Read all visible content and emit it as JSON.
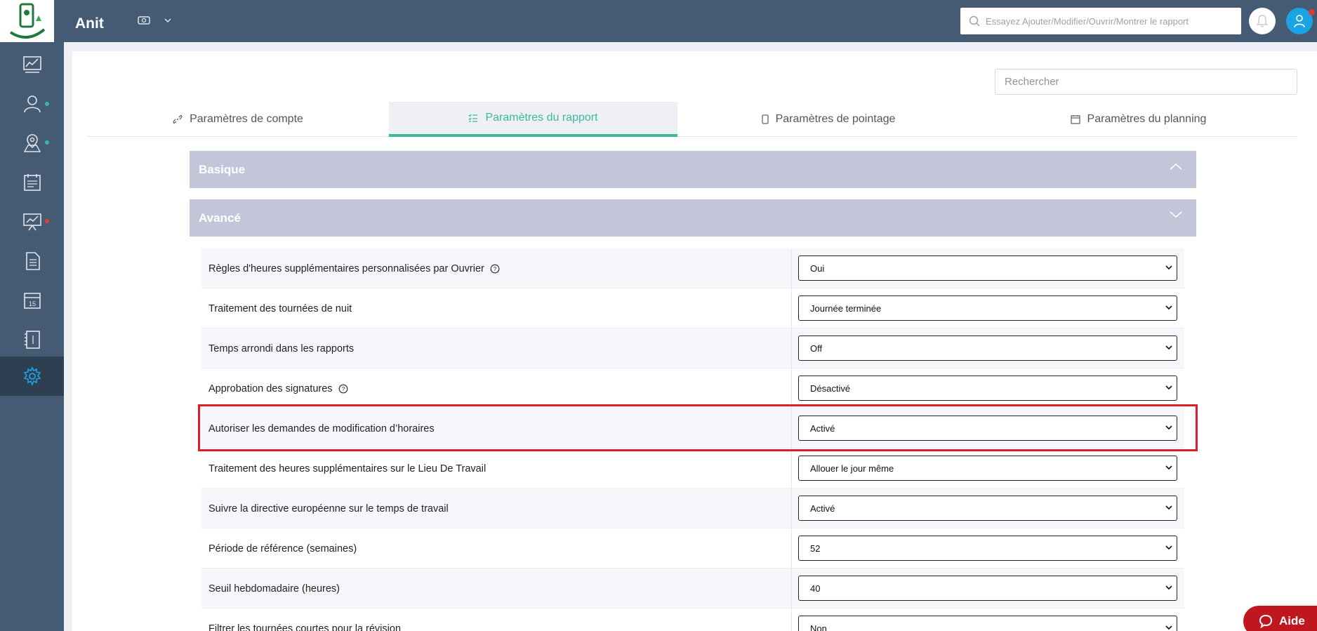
{
  "header": {
    "app_name": "Anit",
    "search_placeholder": "Essayez Ajouter/Modifier/Ouvrir/Montrer le rapport",
    "accent": "#1ba3e3",
    "notification_color": "#e53935"
  },
  "sidebar": {
    "items": [
      {
        "icon": "dashboard-chart-icon"
      },
      {
        "icon": "users-icon",
        "dot": "#3cb89a"
      },
      {
        "icon": "map-pin-icon",
        "dot": "#3cb89a"
      },
      {
        "icon": "calendar-list-icon"
      },
      {
        "icon": "presentation-chart-icon",
        "dot": "#e53935"
      },
      {
        "icon": "document-icon"
      },
      {
        "icon": "calendar-15-icon"
      },
      {
        "icon": "notebook-icon"
      },
      {
        "icon": "settings-gear-icon",
        "active": true
      }
    ]
  },
  "main": {
    "search_placeholder": "Rechercher",
    "tabs": [
      {
        "label": "Paramètres de compte",
        "icon": "link-icon"
      },
      {
        "label": "Paramètres du rapport",
        "icon": "checklist-icon",
        "active": true
      },
      {
        "label": "Paramètres de pointage",
        "icon": "phone-icon"
      },
      {
        "label": "Paramètres du planning",
        "icon": "calendar-icon"
      }
    ],
    "sections": {
      "basic": {
        "title": "Basique",
        "state": "expanded"
      },
      "advanced": {
        "title": "Avancé",
        "state": "collapsed-chevron"
      }
    },
    "settings": [
      {
        "label": "Règles d'heures supplémentaires personnalisées par Ouvrier",
        "value": "Oui",
        "help": true
      },
      {
        "label": "Traitement des tournées de nuit",
        "value": "Journée terminée"
      },
      {
        "label": "Temps arrondi dans les rapports",
        "value": "Off"
      },
      {
        "label": "Approbation des signatures",
        "value": "Désactivé",
        "help": true
      },
      {
        "label": "Autoriser les demandes de modification d’horaires",
        "value": "Activé",
        "highlighted": true
      },
      {
        "label": "Traitement des heures supplémentaires sur le Lieu De Travail",
        "value": "Allouer le jour même"
      },
      {
        "label": "Suivre la directive européenne sur le temps de travail",
        "value": "Activé"
      },
      {
        "label": "Période de référence (semaines)",
        "value": "52"
      },
      {
        "label": "Seuil hebdomadaire (heures)",
        "value": "40"
      },
      {
        "label": "Filtrer les tournées courtes pour la révision",
        "value": "Non"
      }
    ],
    "highlight_color": "#e01e2a",
    "tab_active_color": "#3cb89a"
  },
  "help_button": {
    "label": "Aide",
    "color": "#c01620"
  }
}
